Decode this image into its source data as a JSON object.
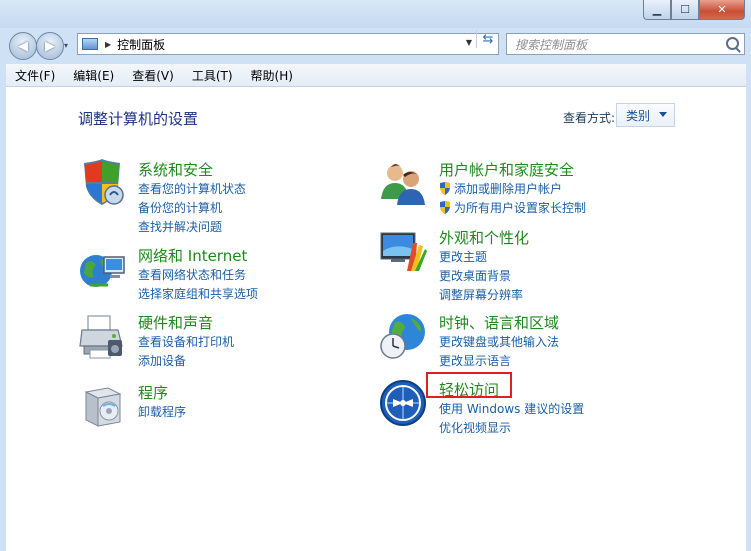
{
  "window": {
    "controls": {
      "minimize": "▁",
      "maximize": "☐",
      "close": "✕"
    }
  },
  "nav": {
    "back": "◀",
    "forward": "▶",
    "history": "▾"
  },
  "address": {
    "crumb": "控制面板",
    "sep": "▶",
    "drop": "▼",
    "refresh": "⇆"
  },
  "search": {
    "placeholder": "搜索控制面板"
  },
  "menubar": {
    "items": [
      "文件(F)",
      "编辑(E)",
      "查看(V)",
      "工具(T)",
      "帮助(H)"
    ]
  },
  "main": {
    "title": "调整计算机的设置",
    "view_by_label": "查看方式:",
    "view_by_value": "类别"
  },
  "categories": [
    {
      "title": "系统和安全",
      "links": [
        "查看您的计算机状态",
        "备份您的计算机",
        "查找并解决问题"
      ]
    },
    {
      "title": "网络和 Internet",
      "links": [
        "查看网络状态和任务",
        "选择家庭组和共享选项"
      ]
    },
    {
      "title": "硬件和声音",
      "links": [
        "查看设备和打印机",
        "添加设备"
      ]
    },
    {
      "title": "程序",
      "links": [
        "卸载程序"
      ]
    },
    {
      "title": "用户帐户和家庭安全",
      "links": [
        "添加或删除用户帐户",
        "为所有用户设置家长控制"
      ]
    },
    {
      "title": "外观和个性化",
      "links": [
        "更改主题",
        "更改桌面背景",
        "调整屏幕分辨率"
      ]
    },
    {
      "title": "时钟、语言和区域",
      "links": [
        "更改键盘或其他输入法",
        "更改显示语言"
      ]
    },
    {
      "title": "轻松访问",
      "links": [
        "使用 Windows 建议的设置",
        "优化视频显示"
      ]
    }
  ],
  "colors": {
    "category_title": "#1e8a1e",
    "link": "#1b5fa8",
    "highlight": "#e02020",
    "page_title": "#1e3287"
  }
}
